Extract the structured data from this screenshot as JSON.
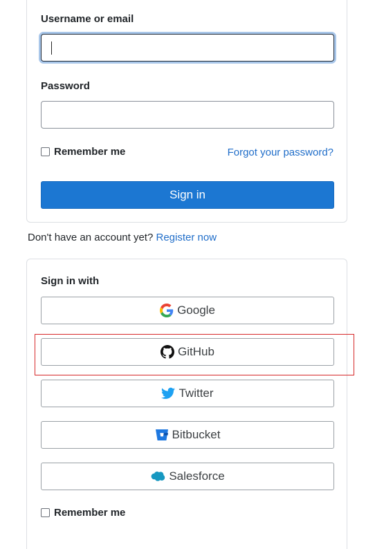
{
  "login": {
    "username_label": "Username or email",
    "username_value": "",
    "password_label": "Password",
    "password_value": "",
    "remember_label": "Remember me",
    "forgot_link": "Forgot your password?",
    "signin_button": "Sign in"
  },
  "register": {
    "prompt": "Don't have an account yet?",
    "link": "Register now"
  },
  "sso": {
    "heading": "Sign in with",
    "providers": [
      {
        "label": "Google",
        "icon": "google-icon"
      },
      {
        "label": "GitHub",
        "icon": "github-icon"
      },
      {
        "label": "Twitter",
        "icon": "twitter-icon"
      },
      {
        "label": "Bitbucket",
        "icon": "bitbucket-icon"
      },
      {
        "label": "Salesforce",
        "icon": "salesforce-icon"
      }
    ],
    "remember_label": "Remember me"
  },
  "colors": {
    "primary": "#1c77d2",
    "link": "#1f6dc9",
    "highlight": "#d62728"
  }
}
